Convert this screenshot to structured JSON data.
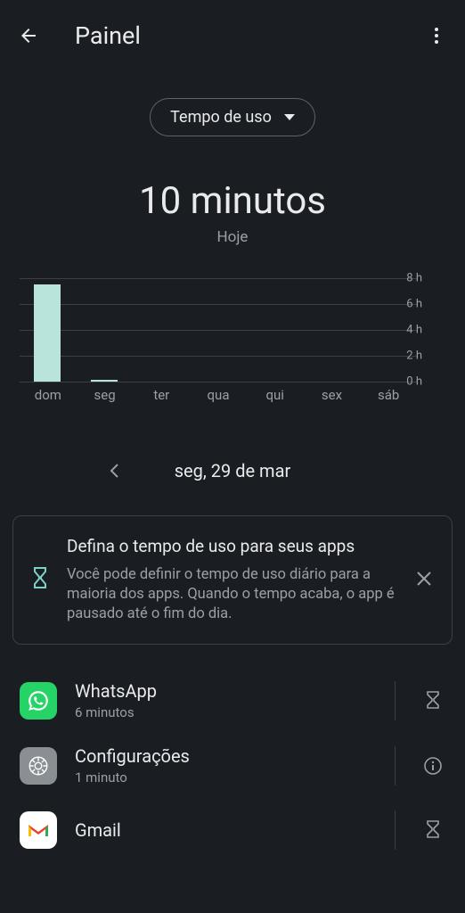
{
  "header": {
    "title": "Painel"
  },
  "dropdown": {
    "label": "Tempo de uso"
  },
  "total": {
    "value": "10 minutos",
    "label": "Hoje"
  },
  "chart_data": {
    "type": "bar",
    "categories": [
      "dom",
      "seg",
      "ter",
      "qua",
      "qui",
      "sex",
      "sáb"
    ],
    "values": [
      7.5,
      0.17,
      0,
      0,
      0,
      0,
      0
    ],
    "ylabel": "",
    "ylim": [
      0,
      8
    ],
    "yticks": [
      "0 h",
      "2 h",
      "4 h",
      "6 h",
      "8 h"
    ],
    "unit": "h"
  },
  "date_nav": {
    "current": "seg, 29 de mar"
  },
  "info_card": {
    "title": "Defina o tempo de uso para seus apps",
    "description": "Você pode definir o tempo de uso diário para a maioria dos apps. Quando o tempo acaba, o app é pausado até o fim do dia."
  },
  "apps": [
    {
      "name": "WhatsApp",
      "time": "6 minutos",
      "icon": "whatsapp",
      "action": "hourglass"
    },
    {
      "name": "Configurações",
      "time": "1 minuto",
      "icon": "settings",
      "action": "info"
    },
    {
      "name": "Gmail",
      "time": "",
      "icon": "gmail",
      "action": "hourglass"
    }
  ]
}
